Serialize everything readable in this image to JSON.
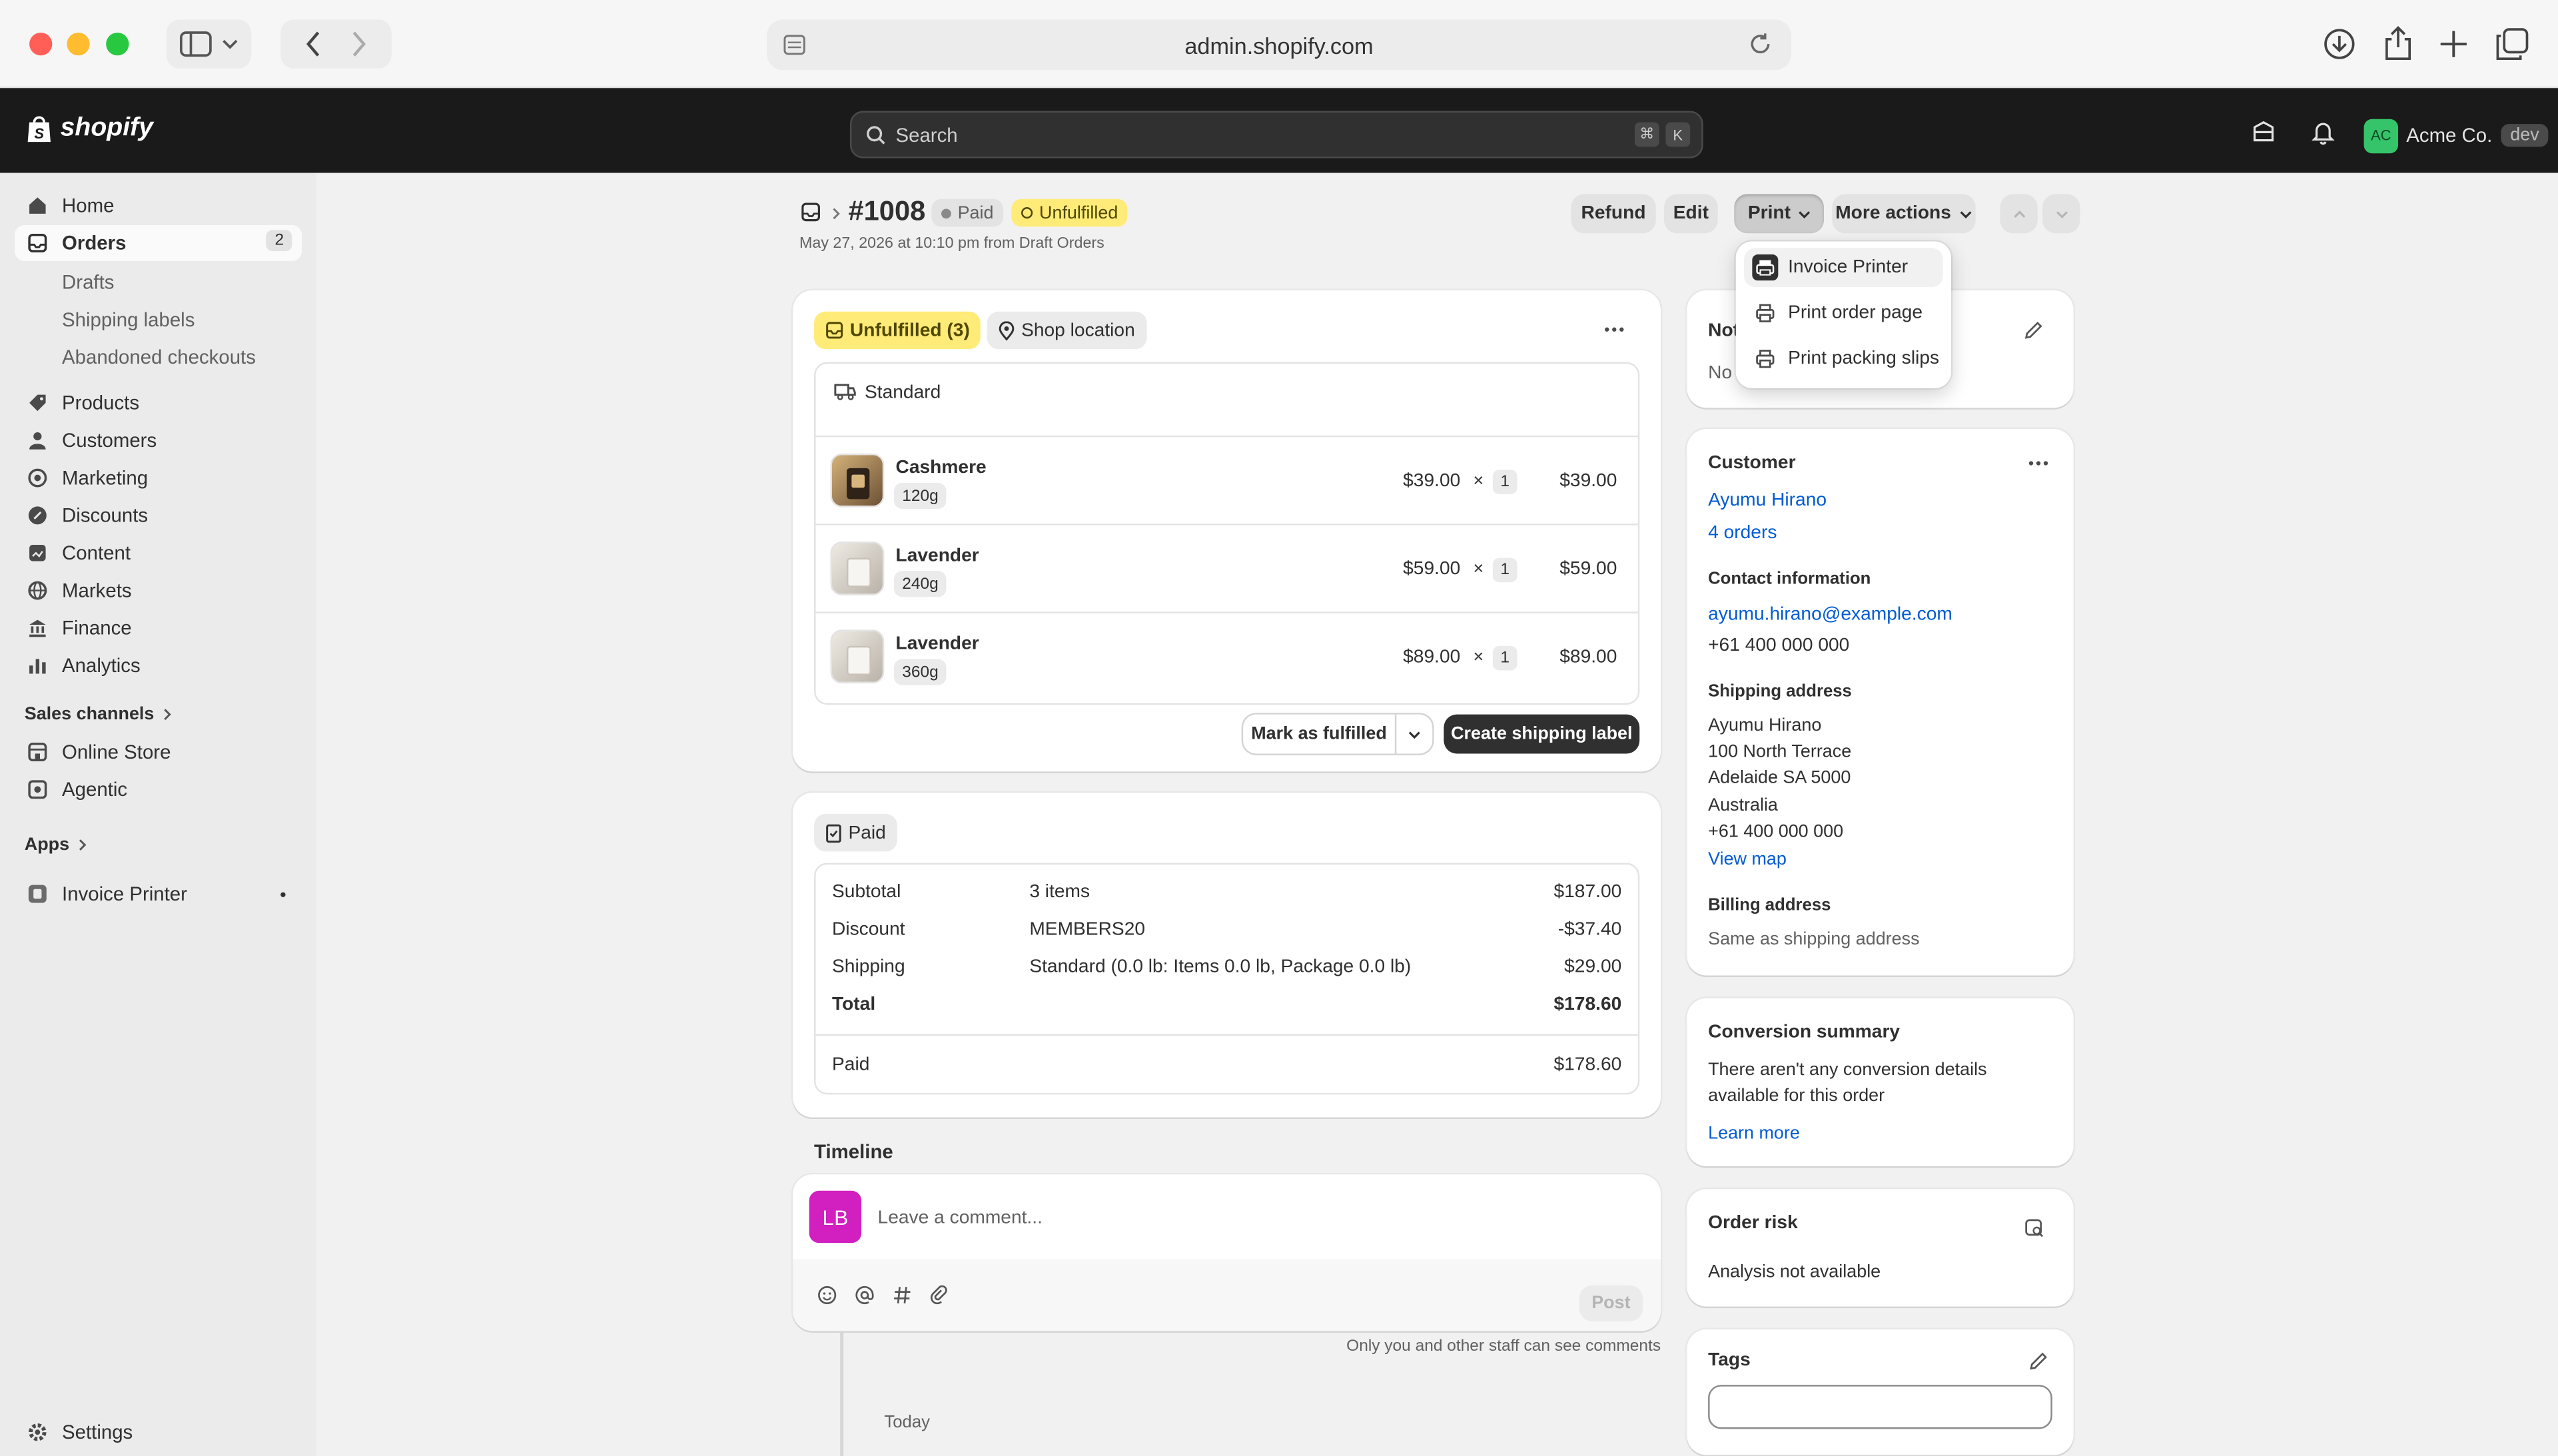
{
  "browser": {
    "url": "admin.shopify.com"
  },
  "topbar": {
    "brand": "shopify",
    "search_placeholder": "Search",
    "shortcut_cmd": "⌘",
    "shortcut_key": "K",
    "store_initials": "AC",
    "store_name": "Acme Co.",
    "store_badge": "dev"
  },
  "sidebar": {
    "home": "Home",
    "orders": "Orders",
    "orders_count": "2",
    "drafts": "Drafts",
    "shipping_labels": "Shipping labels",
    "abandoned": "Abandoned checkouts",
    "products": "Products",
    "customers": "Customers",
    "marketing": "Marketing",
    "discounts": "Discounts",
    "content": "Content",
    "markets": "Markets",
    "finance": "Finance",
    "analytics": "Analytics",
    "sales_channels": "Sales channels",
    "online_store": "Online Store",
    "agentic": "Agentic",
    "apps": "Apps",
    "invoice_printer": "Invoice Printer",
    "settings": "Settings"
  },
  "order": {
    "number": "#1008",
    "payment_status": "Paid",
    "fulfillment_status": "Unfulfilled",
    "subtitle": "May 27, 2026 at 10:10 pm from Draft Orders",
    "actions": {
      "refund": "Refund",
      "edit": "Edit",
      "print": "Print",
      "more": "More actions"
    }
  },
  "print_menu": {
    "items": [
      "Invoice Printer",
      "Print order page",
      "Print packing slips"
    ]
  },
  "fulfillment": {
    "badge": "Unfulfilled (3)",
    "location": "Shop location",
    "method": "Standard",
    "items": [
      {
        "name": "Cashmere",
        "variant": "120g",
        "price": "$39.00",
        "times": "×",
        "qty": "1",
        "total": "$39.00"
      },
      {
        "name": "Lavender",
        "variant": "240g",
        "price": "$59.00",
        "times": "×",
        "qty": "1",
        "total": "$59.00"
      },
      {
        "name": "Lavender",
        "variant": "360g",
        "price": "$89.00",
        "times": "×",
        "qty": "1",
        "total": "$89.00"
      }
    ],
    "mark_fulfilled": "Mark as fulfilled",
    "create_label": "Create shipping label"
  },
  "payment": {
    "badge": "Paid",
    "rows": [
      {
        "label": "Subtotal",
        "desc": "3 items",
        "amount": "$187.00"
      },
      {
        "label": "Discount",
        "desc": "MEMBERS20",
        "amount": "-$37.40"
      },
      {
        "label": "Shipping",
        "desc": "Standard (0.0 lb: Items 0.0 lb, Package 0.0 lb)",
        "amount": "$29.00"
      },
      {
        "label": "Total",
        "desc": "",
        "amount": "$178.60"
      }
    ],
    "paid_label": "Paid",
    "paid_amount": "$178.60"
  },
  "timeline": {
    "title": "Timeline",
    "avatar": "LB",
    "placeholder": "Leave a comment...",
    "post": "Post",
    "note": "Only you and other staff can see comments",
    "today": "Today"
  },
  "notes": {
    "title_partial": "Not",
    "body_partial": "No"
  },
  "customer": {
    "title": "Customer",
    "name": "Ayumu Hirano",
    "orders": "4 orders",
    "contact_title": "Contact information",
    "email": "ayumu.hirano@example.com",
    "phone": "+61 400 000 000",
    "shipping_title": "Shipping address",
    "address": [
      "Ayumu Hirano",
      "100 North Terrace",
      "Adelaide SA 5000",
      "Australia",
      "+61 400 000 000"
    ],
    "view_map": "View map",
    "billing_title": "Billing address",
    "billing": "Same as shipping address"
  },
  "conversion": {
    "title": "Conversion summary",
    "line1": "There aren't any conversion details",
    "line2": "available for this order",
    "learn_more": "Learn more"
  },
  "risk": {
    "title": "Order risk",
    "body": "Analysis not available"
  },
  "tags": {
    "title": "Tags",
    "value": ""
  },
  "colors": {
    "topbar": "#1a1a1a",
    "accent_link": "#005bd3",
    "unfulfilled_badge": "#ffeb78",
    "primary_button": "#303030"
  }
}
